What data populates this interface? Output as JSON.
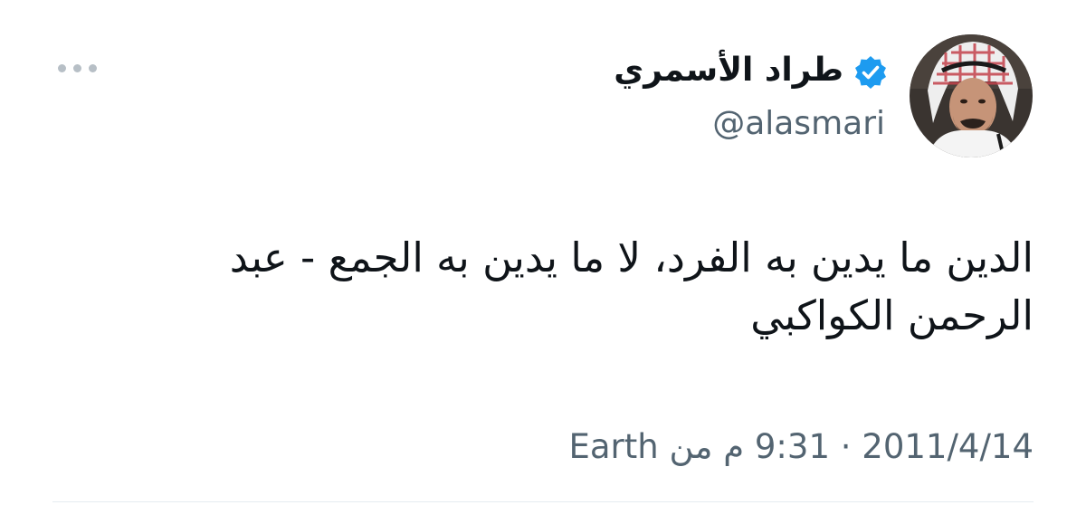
{
  "tweet": {
    "author": {
      "display_name": "طراد الأسمري",
      "handle": "@alasmari",
      "verified": true,
      "verified_color": "#1d9bf0"
    },
    "text": "الدين ما يدين به الفرد، لا ما يدين به الجمع - عبد الرحمن الكواكبي",
    "timestamp": "2011/4/14 · 9:31 م من Earth"
  },
  "icons": {
    "more": "more-dots-icon",
    "verified": "verified-badge-icon",
    "avatar": "profile-photo"
  }
}
